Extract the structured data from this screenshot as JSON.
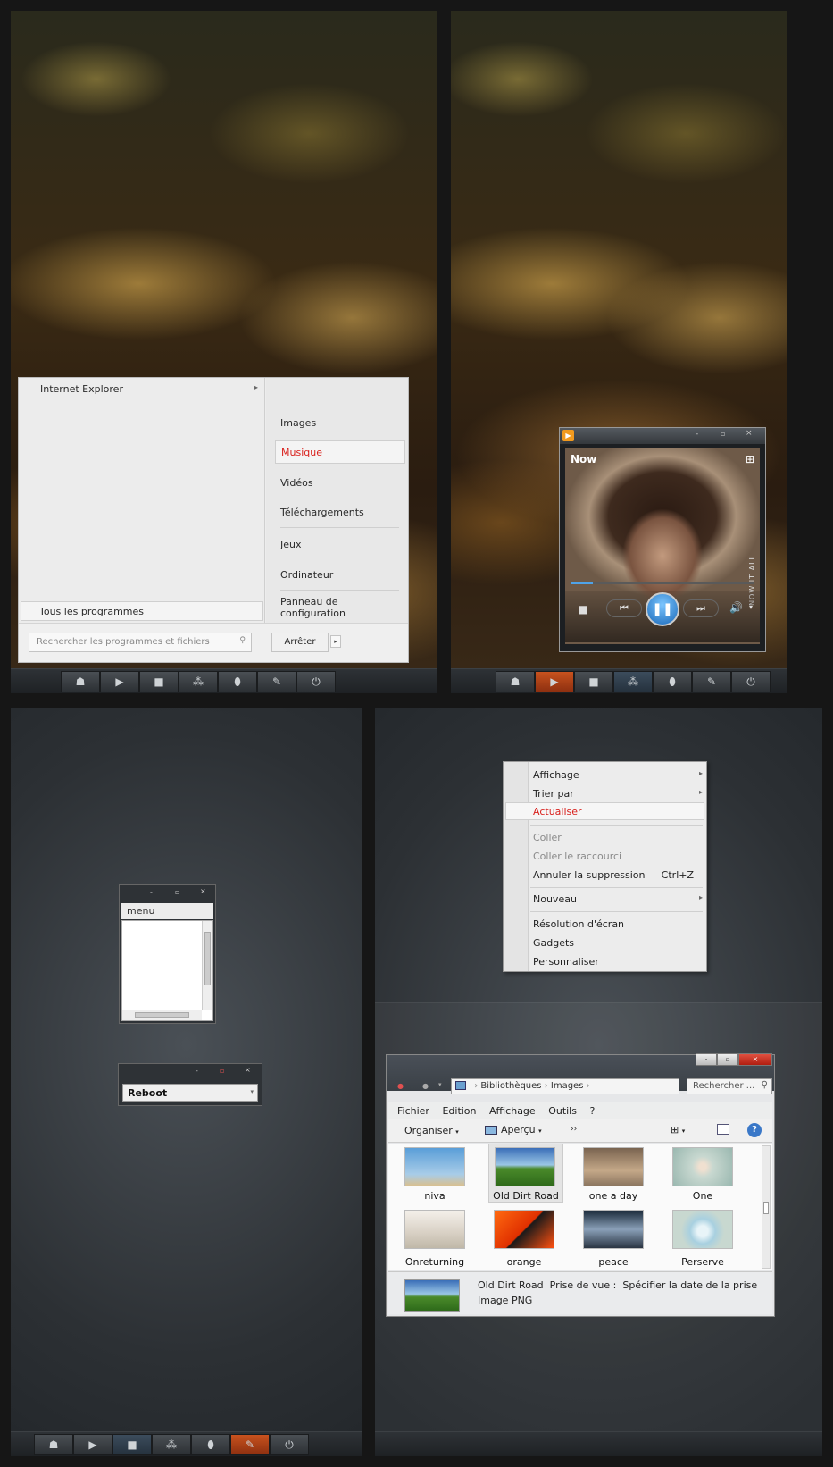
{
  "start_menu": {
    "left_item": "Internet Explorer",
    "all_programs": "Tous les programmes",
    "right_items": [
      "Images",
      "Musique",
      "Vidéos",
      "Téléchargements",
      "Jeux",
      "Ordinateur",
      "Panneau de configuration"
    ],
    "search_placeholder": "Rechercher les programmes et fichiers",
    "shutdown": "Arrêter"
  },
  "media_player": {
    "header": "Now",
    "art_text": "NOW   IT ALL"
  },
  "mini_window": {
    "menu": "menu"
  },
  "reboot_window": {
    "value": "Reboot"
  },
  "context_menu": {
    "items": [
      {
        "label": "Affichage",
        "sub": true
      },
      {
        "label": "Trier par",
        "sub": true
      },
      {
        "label": "Actualiser",
        "highlight": true
      },
      {
        "label": "Coller",
        "disabled": true
      },
      {
        "label": "Coller le raccourci",
        "disabled": true
      },
      {
        "label": "Annuler la suppression",
        "shortcut": "Ctrl+Z"
      },
      {
        "label": "Nouveau",
        "sub": true
      },
      {
        "label": "Résolution d'écran"
      },
      {
        "label": "Gadgets"
      },
      {
        "label": "Personnaliser"
      }
    ]
  },
  "explorer": {
    "breadcrumb": [
      "Bibliothèques",
      "Images"
    ],
    "search_placeholder": "Rechercher ...",
    "menu": [
      "Fichier",
      "Edition",
      "Affichage",
      "Outils",
      "?"
    ],
    "toolbar": {
      "organize": "Organiser",
      "preview": "Aperçu"
    },
    "thumbnails": [
      {
        "label": "niva"
      },
      {
        "label": "Old Dirt Road",
        "selected": true
      },
      {
        "label": "one a day"
      },
      {
        "label": "One"
      },
      {
        "label": "Onreturning"
      },
      {
        "label": "orange"
      },
      {
        "label": "peace"
      },
      {
        "label": "Perserve"
      }
    ],
    "details": {
      "name": "Old Dirt Road",
      "field_label": "Prise de vue :",
      "field_value": "Spécifier la date de la prise",
      "type": "Image PNG"
    }
  },
  "colors": {
    "accent": "#d9201c",
    "taskbar_active": "#c8521e"
  }
}
